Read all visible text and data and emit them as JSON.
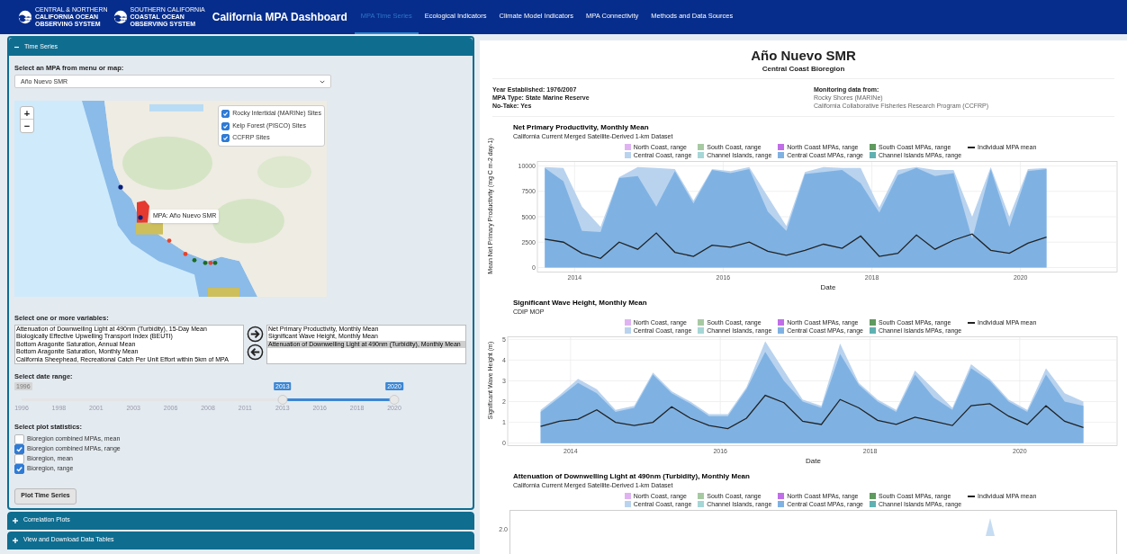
{
  "header": {
    "logos": [
      {
        "lines": [
          "CENTRAL & NORTHERN",
          "CALIFORNIA OCEAN",
          "OBSERVING SYSTEM"
        ]
      },
      {
        "lines": [
          "SOUTHERN CALIFORNIA",
          "COASTAL OCEAN",
          "OBSERVING SYSTEM"
        ]
      }
    ],
    "title": "California MPA Dashboard",
    "tabs": [
      {
        "label": "MPA Time Series",
        "selected": true
      },
      {
        "label": "Ecological Indicators",
        "selected": false
      },
      {
        "label": "Climate Model Indicators",
        "selected": false
      },
      {
        "label": "MPA Connectivity",
        "selected": false
      },
      {
        "label": "Methods and Data Sources",
        "selected": false
      }
    ]
  },
  "time_series_panel": {
    "title": "Time Series",
    "expanded": true,
    "mpa_select": {
      "label": "Select an MPA from menu or map:",
      "value": "Año Nuevo SMR"
    },
    "map": {
      "zoom_in": "+",
      "zoom_out": "−",
      "tooltip": "MPA: Año Nuevo SMR",
      "layers": [
        {
          "label": "Rocky Intertidal (MARINe) Sites",
          "checked": true
        },
        {
          "label": "Kelp Forest (PISCO) Sites",
          "checked": true
        },
        {
          "label": "CCFRP Sites",
          "checked": true
        }
      ]
    },
    "variables": {
      "label": "Select one or more variables:",
      "available": [
        {
          "label": "Attenuation of Downwelling Light at 490nm (Turbidity), 15-Day Mean",
          "selected": false
        },
        {
          "label": "Biologically Effective Upwelling Transport Index (BEUTI)",
          "selected": false
        },
        {
          "label": "Bottom Aragonite Saturation, Annual Mean",
          "selected": false
        },
        {
          "label": "Bottom Aragonite Saturation, Monthly Mean",
          "selected": false
        },
        {
          "label": "California Sheephead, Recreational Catch Per Unit Effort within 5km of MPA",
          "selected": false
        }
      ],
      "chosen": [
        {
          "label": "Net Primary Productivity, Monthly Mean",
          "selected": false
        },
        {
          "label": "Significant Wave Height, Monthly Mean",
          "selected": false
        },
        {
          "label": "Attenuation of Downwelling Light at 490nm (Turbidity), Monthly Mean",
          "selected": true
        }
      ]
    },
    "date_range": {
      "label": "Select date range:",
      "min_label": "1996",
      "ticks": [
        "1996",
        "1998",
        "2001",
        "2003",
        "2006",
        "2008",
        "2011",
        "2013",
        "2016",
        "2018",
        "2020"
      ],
      "handles": [
        {
          "label": "2013",
          "level": 0.7
        },
        {
          "label": "2020",
          "level": 1
        }
      ]
    },
    "plot_statistics": {
      "label": "Select plot statistics:",
      "options": [
        {
          "label": "Bioregion combined MPAs, mean",
          "checked": false
        },
        {
          "label": "Bioregion combined MPAs, range",
          "checked": true
        },
        {
          "label": "Bioregion, mean",
          "checked": false
        },
        {
          "label": "Bioregion, range",
          "checked": true
        }
      ]
    },
    "button": "Plot Time Series"
  },
  "collapsed_panels": [
    {
      "title": "Correlation Plots",
      "expanded": false
    },
    {
      "title": "View and Download Data Tables",
      "expanded": false
    }
  ],
  "site": {
    "name": "Año Nuevo SMR",
    "bioregion": "Central Coast Bioregion",
    "details": [
      "Year Established: 1976/2007",
      "MPA Type: State Marine Reserve",
      "No-Take: Yes"
    ],
    "monitoring": {
      "heading": "Monitoring data from:",
      "sources": [
        "Rocky Shores (MARINe)",
        "California Collaborative Fisheries Research Program (CCFRP)"
      ]
    }
  },
  "charts": [
    {
      "title": "Net Primary Productivity, Monthly Mean",
      "subtitle": "California Current Merged Satellite-Derived 1-km Dataset",
      "chart_data": {
        "type": "area",
        "grid": true,
        "xlabel": "Date",
        "ylabel": "Mean Net Primary Productivity (mg C m-2 day-1)",
        "xlim": [
          2013.5,
          2021.3
        ],
        "ylim": [
          -400,
          10400
        ],
        "xticks": [
          2014,
          2016,
          2018,
          2020
        ],
        "yticks": [
          0,
          2500,
          5000,
          7500,
          10000
        ],
        "x": [
          2013.6,
          2013.85,
          2014.1,
          2014.35,
          2014.6,
          2014.85,
          2015.1,
          2015.35,
          2015.6,
          2015.85,
          2016.1,
          2016.35,
          2016.6,
          2016.85,
          2017.1,
          2017.35,
          2017.6,
          2017.85,
          2018.1,
          2018.35,
          2018.6,
          2018.85,
          2019.1,
          2019.35,
          2019.6,
          2019.85,
          2020.1,
          2020.35
        ],
        "series": [
          {
            "name": "North Coast, range",
            "type": "area",
            "color": "#dfb3f2",
            "values": [
              null,
              null,
              null,
              null,
              null,
              null,
              null,
              null,
              null,
              null,
              null,
              null,
              null,
              null,
              null,
              null,
              null,
              null,
              null,
              null,
              null,
              null,
              null,
              null,
              null,
              null,
              null,
              null
            ]
          },
          {
            "name": "Central Coast, range",
            "type": "area",
            "color": "#b9d3ef",
            "values": [
              9900,
              9800,
              6000,
              4000,
              8900,
              9900,
              9800,
              9700,
              6600,
              9700,
              9500,
              9900,
              7000,
              4100,
              9400,
              9900,
              9800,
              9800,
              5900,
              9600,
              9900,
              9600,
              9600,
              5000,
              9900,
              5000,
              9700,
              9800
            ]
          },
          {
            "name": "South Coast, range",
            "type": "area",
            "color": "#a7c9a2",
            "values": [
              null,
              null,
              null,
              null,
              null,
              null,
              null,
              null,
              null,
              null,
              null,
              null,
              null,
              null,
              null,
              null,
              null,
              null,
              null,
              null,
              null,
              null,
              null,
              null,
              null,
              null,
              null,
              null
            ]
          },
          {
            "name": "Channel Islands, range",
            "type": "area",
            "color": "#a6d6d6",
            "values": [
              null,
              null,
              null,
              null,
              null,
              null,
              null,
              null,
              null,
              null,
              null,
              null,
              null,
              null,
              null,
              null,
              null,
              null,
              null,
              null,
              null,
              null,
              null,
              null,
              null,
              null,
              null,
              null
            ]
          },
          {
            "name": "North Coast MPAs, range",
            "type": "area",
            "color": "#c06ee8",
            "values": [
              null,
              null,
              null,
              null,
              null,
              null,
              null,
              null,
              null,
              null,
              null,
              null,
              null,
              null,
              null,
              null,
              null,
              null,
              null,
              null,
              null,
              null,
              null,
              null,
              null,
              null,
              null,
              null
            ]
          },
          {
            "name": "Central Coast MPAs, range",
            "type": "area",
            "color": "#7fb2e3",
            "values": [
              9800,
              8500,
              3600,
              3500,
              8800,
              9000,
              6000,
              9500,
              6300,
              9600,
              9300,
              9700,
              5500,
              3600,
              9200,
              9400,
              9600,
              8300,
              5400,
              9100,
              9800,
              9000,
              9300,
              2800,
              9700,
              4000,
              9500,
              9700
            ]
          },
          {
            "name": "South Coast MPAs, range",
            "type": "area",
            "color": "#5f9a5e",
            "values": [
              null,
              null,
              null,
              null,
              null,
              null,
              null,
              null,
              null,
              null,
              null,
              null,
              null,
              null,
              null,
              null,
              null,
              null,
              null,
              null,
              null,
              null,
              null,
              null,
              null,
              null,
              null,
              null
            ]
          },
          {
            "name": "Channel Islands MPAs, range",
            "type": "area",
            "color": "#5fb1b1",
            "values": [
              null,
              null,
              null,
              null,
              null,
              null,
              null,
              null,
              null,
              null,
              null,
              null,
              null,
              null,
              null,
              null,
              null,
              null,
              null,
              null,
              null,
              null,
              null,
              null,
              null,
              null,
              null,
              null
            ]
          },
          {
            "name": "Individual MPA mean",
            "type": "line",
            "color": "#222222",
            "values": [
              2800,
              2500,
              1400,
              900,
              2500,
              1800,
              3400,
              1500,
              1100,
              2200,
              2000,
              2500,
              1600,
              1200,
              1700,
              2300,
              1900,
              3100,
              1100,
              1400,
              3200,
              1800,
              2700,
              3300,
              1700,
              1400,
              2400,
              3000
            ]
          }
        ]
      }
    },
    {
      "title": "Significant Wave Height, Monthly Mean",
      "subtitle": "CDIP MOP",
      "chart_data": {
        "type": "area",
        "grid": true,
        "xlabel": "Date",
        "ylabel": "Significant Wave Height (m)",
        "xlim": [
          2013.16,
          2021.3
        ],
        "ylim": [
          -0.1,
          5.1
        ],
        "xticks": [
          2014,
          2016,
          2018,
          2020
        ],
        "yticks": [
          0,
          1,
          2,
          3,
          4,
          5
        ],
        "x": [
          2013.6,
          2013.85,
          2014.1,
          2014.35,
          2014.6,
          2014.85,
          2015.1,
          2015.35,
          2015.6,
          2015.85,
          2016.1,
          2016.35,
          2016.6,
          2016.85,
          2017.1,
          2017.35,
          2017.6,
          2017.85,
          2018.1,
          2018.35,
          2018.6,
          2018.85,
          2019.1,
          2019.35,
          2019.6,
          2019.85,
          2020.1,
          2020.35,
          2020.6,
          2020.85
        ],
        "series": [
          {
            "name": "North Coast, range",
            "type": "area",
            "color": "#dfb3f2",
            "values": [
              null,
              null,
              null,
              null,
              null,
              null,
              null,
              null,
              null,
              null,
              null,
              null,
              null,
              null,
              null,
              null,
              null,
              null,
              null,
              null,
              null,
              null,
              null,
              null,
              null,
              null,
              null,
              null,
              null,
              null
            ]
          },
          {
            "name": "Central Coast, range",
            "type": "area",
            "color": "#b9d3ef",
            "values": [
              1.6,
              2.3,
              3.1,
              2.6,
              1.6,
              1.8,
              3.4,
              2.5,
              2.0,
              1.4,
              1.4,
              2.7,
              4.9,
              3.5,
              2.1,
              1.8,
              4.8,
              2.9,
              2.1,
              1.6,
              3.5,
              2.6,
              1.7,
              3.8,
              3.1,
              2.1,
              1.6,
              3.6,
              2.4,
              2.0
            ]
          },
          {
            "name": "South Coast, range",
            "type": "area",
            "color": "#a7c9a2",
            "values": [
              null,
              null,
              null,
              null,
              null,
              null,
              null,
              null,
              null,
              null,
              null,
              null,
              null,
              null,
              null,
              null,
              null,
              null,
              null,
              null,
              null,
              null,
              null,
              null,
              null,
              null,
              null,
              null,
              null,
              null
            ]
          },
          {
            "name": "Channel Islands, range",
            "type": "area",
            "color": "#a6d6d6",
            "values": [
              null,
              null,
              null,
              null,
              null,
              null,
              null,
              null,
              null,
              null,
              null,
              null,
              null,
              null,
              null,
              null,
              null,
              null,
              null,
              null,
              null,
              null,
              null,
              null,
              null,
              null,
              null,
              null,
              null,
              null
            ]
          },
          {
            "name": "North Coast MPAs, range",
            "type": "area",
            "color": "#c06ee8",
            "values": [
              null,
              null,
              null,
              null,
              null,
              null,
              null,
              null,
              null,
              null,
              null,
              null,
              null,
              null,
              null,
              null,
              null,
              null,
              null,
              null,
              null,
              null,
              null,
              null,
              null,
              null,
              null,
              null,
              null,
              null
            ]
          },
          {
            "name": "Central Coast MPAs, range",
            "type": "area",
            "color": "#7fb2e3",
            "values": [
              1.5,
              2.2,
              2.9,
              2.4,
              1.5,
              1.7,
              3.3,
              2.4,
              1.9,
              1.3,
              1.3,
              2.6,
              4.4,
              3.0,
              2.0,
              1.7,
              4.3,
              2.8,
              2.0,
              1.5,
              3.3,
              2.2,
              1.6,
              3.6,
              3.0,
              2.0,
              1.5,
              3.3,
              2.0,
              1.8
            ]
          },
          {
            "name": "South Coast MPAs, range",
            "type": "area",
            "color": "#5f9a5e",
            "values": [
              null,
              null,
              null,
              null,
              null,
              null,
              null,
              null,
              null,
              null,
              null,
              null,
              null,
              null,
              null,
              null,
              null,
              null,
              null,
              null,
              null,
              null,
              null,
              null,
              null,
              null,
              null,
              null,
              null,
              null
            ]
          },
          {
            "name": "Channel Islands MPAs, range",
            "type": "area",
            "color": "#5fb1b1",
            "values": [
              null,
              null,
              null,
              null,
              null,
              null,
              null,
              null,
              null,
              null,
              null,
              null,
              null,
              null,
              null,
              null,
              null,
              null,
              null,
              null,
              null,
              null,
              null,
              null,
              null,
              null,
              null,
              null,
              null,
              null
            ]
          },
          {
            "name": "Individual MPA mean",
            "type": "line",
            "color": "#222222",
            "values": [
              0.8,
              1.05,
              1.15,
              1.6,
              1.0,
              0.85,
              1.0,
              1.75,
              1.2,
              0.85,
              0.7,
              1.2,
              2.3,
              1.95,
              1.05,
              0.9,
              2.1,
              1.7,
              1.1,
              0.9,
              1.25,
              1.05,
              0.85,
              1.8,
              1.9,
              1.3,
              0.9,
              1.8,
              1.05,
              0.75
            ]
          }
        ]
      }
    },
    {
      "title": "Attenuation of Downwelling Light at 490nm (Turbidity), Monthly Mean",
      "subtitle": "California Current Merged Satellite-Derived 1-km Dataset",
      "y_tick": "2.0",
      "legend": [
        {
          "label": "North Coast, range",
          "color": "#dfb3f2",
          "kind": "swatch"
        },
        {
          "label": "Central Coast, range",
          "color": "#b9d3ef",
          "kind": "swatch"
        },
        {
          "label": "South Coast, range",
          "color": "#a7c9a2",
          "kind": "swatch"
        },
        {
          "label": "Channel Islands, range",
          "color": "#a6d6d6",
          "kind": "swatch"
        },
        {
          "label": "North Coast MPAs, range",
          "color": "#c06ee8",
          "kind": "swatch"
        },
        {
          "label": "Central Coast MPAs, range",
          "color": "#7fb2e3",
          "kind": "swatch"
        },
        {
          "label": "South Coast MPAs, range",
          "color": "#5f9a5e",
          "kind": "swatch"
        },
        {
          "label": "Channel Islands MPAs, range",
          "color": "#5fb1b1",
          "kind": "swatch"
        },
        {
          "label": "Individual MPA mean",
          "color": "#222222",
          "kind": "line"
        }
      ]
    }
  ]
}
